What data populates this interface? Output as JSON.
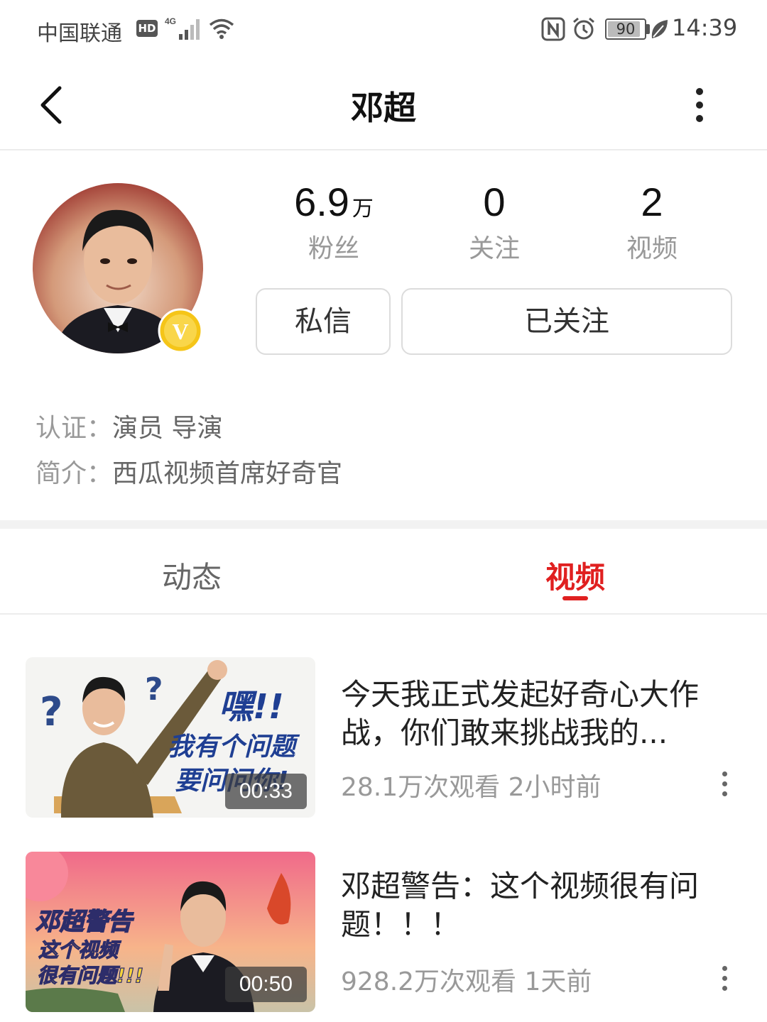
{
  "status_bar": {
    "carrier": "中国联通",
    "hd": "HD",
    "network": "4G",
    "battery": "90",
    "battery_level": 0.9,
    "time": "14:39"
  },
  "header": {
    "title": "邓超"
  },
  "profile": {
    "verified_badge": "V",
    "stats": [
      {
        "value": "6.9",
        "unit": "万",
        "label": "粉丝"
      },
      {
        "value": "0",
        "unit": "",
        "label": "关注"
      },
      {
        "value": "2",
        "unit": "",
        "label": "视频"
      }
    ],
    "message_label": "私信",
    "follow_label": "已关注",
    "certification_label": "认证：",
    "certification_value": "演员 导演",
    "intro_label": "简介：",
    "intro_value": "西瓜视频首席好奇官"
  },
  "tabs": [
    {
      "label": "动态",
      "active": false
    },
    {
      "label": "视频",
      "active": true
    }
  ],
  "videos": [
    {
      "title": "今天我正式发起好奇心大作战，你们敢来挑战我的...",
      "duration": "00:33",
      "views": "28.1万次观看",
      "time": "2小时前",
      "thumb_text": [
        "嘿!!",
        "我有个问题",
        "要问问你!"
      ]
    },
    {
      "title": "邓超警告：这个视频很有问题！！！",
      "duration": "00:50",
      "views": "928.2万次观看",
      "time": "1天前",
      "thumb_text": [
        "邓超警告",
        "这个视频",
        "很有问题!!!"
      ]
    }
  ],
  "colors": {
    "accent": "#e02020",
    "muted": "#999999",
    "border": "#dcdcdc"
  }
}
